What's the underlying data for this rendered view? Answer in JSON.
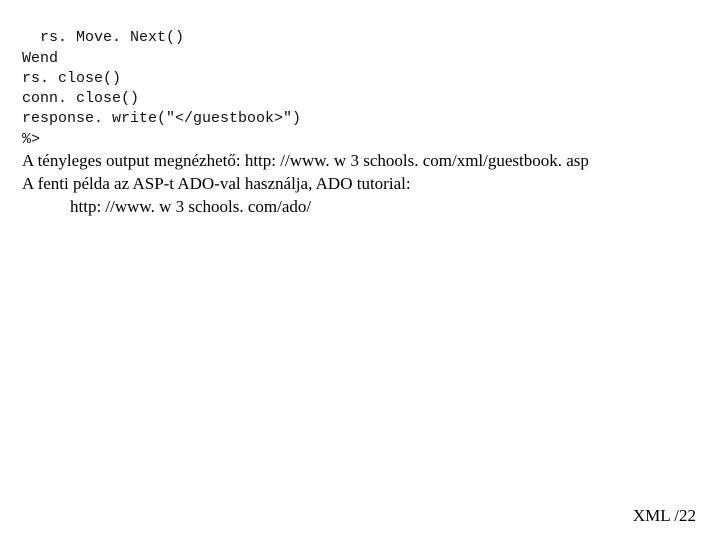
{
  "code": {
    "l1": "  rs. Move. Next()",
    "l2": "Wend",
    "l3": "rs. close()",
    "l4": "conn. close()",
    "l5": "response. write(\"</guestbook>\")",
    "l6": "%>"
  },
  "prose": {
    "p1": "A tényleges output megnézhető: http: //www. w 3 schools. com/xml/guestbook. asp",
    "p2": "A fenti példa az ASP-t ADO-val használja, ADO tutorial:",
    "p3": "http: //www. w 3 schools. com/ado/"
  },
  "footer": {
    "label": "XML /22"
  }
}
